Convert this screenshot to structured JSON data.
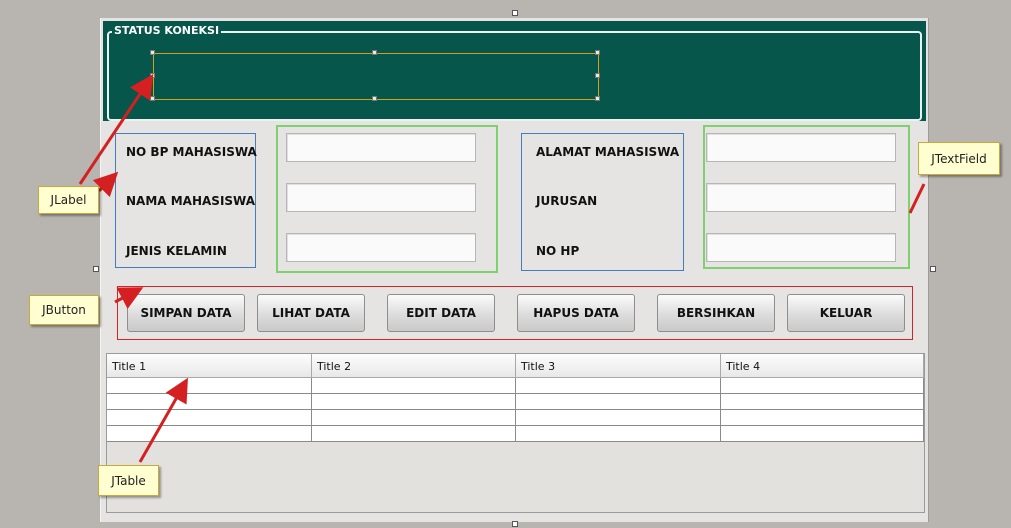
{
  "status": {
    "title": "STATUS KONEKSI",
    "label_text": ""
  },
  "labels_left": [
    "NO BP MAHASISWA",
    "NAMA MAHASISWA",
    "JENIS KELAMIN"
  ],
  "labels_right": [
    "ALAMAT MAHASISWA",
    "JURUSAN",
    "NO HP"
  ],
  "fields_left": [
    "",
    "",
    ""
  ],
  "fields_right": [
    "",
    "",
    ""
  ],
  "buttons": [
    "SIMPAN DATA",
    "LIHAT DATA",
    "EDIT DATA",
    "HAPUS DATA",
    "BERSIHKAN",
    "KELUAR"
  ],
  "table": {
    "columns": [
      "Title 1",
      "Title 2",
      "Title 3",
      "Title 4"
    ],
    "rows": [
      [
        "",
        "",
        "",
        ""
      ],
      [
        "",
        "",
        "",
        ""
      ],
      [
        "",
        "",
        "",
        ""
      ],
      [
        "",
        "",
        "",
        ""
      ]
    ]
  },
  "callouts": {
    "jlabel": "JLabel",
    "jtextfield": "JTextField",
    "jbutton": "JButton",
    "jtable": "JTable"
  },
  "colors": {
    "status_bg": "#06564c",
    "label_border": "#3f7fbf",
    "field_border": "#7fd06f",
    "button_border": "#d4242a",
    "arrow": "#d42020"
  }
}
